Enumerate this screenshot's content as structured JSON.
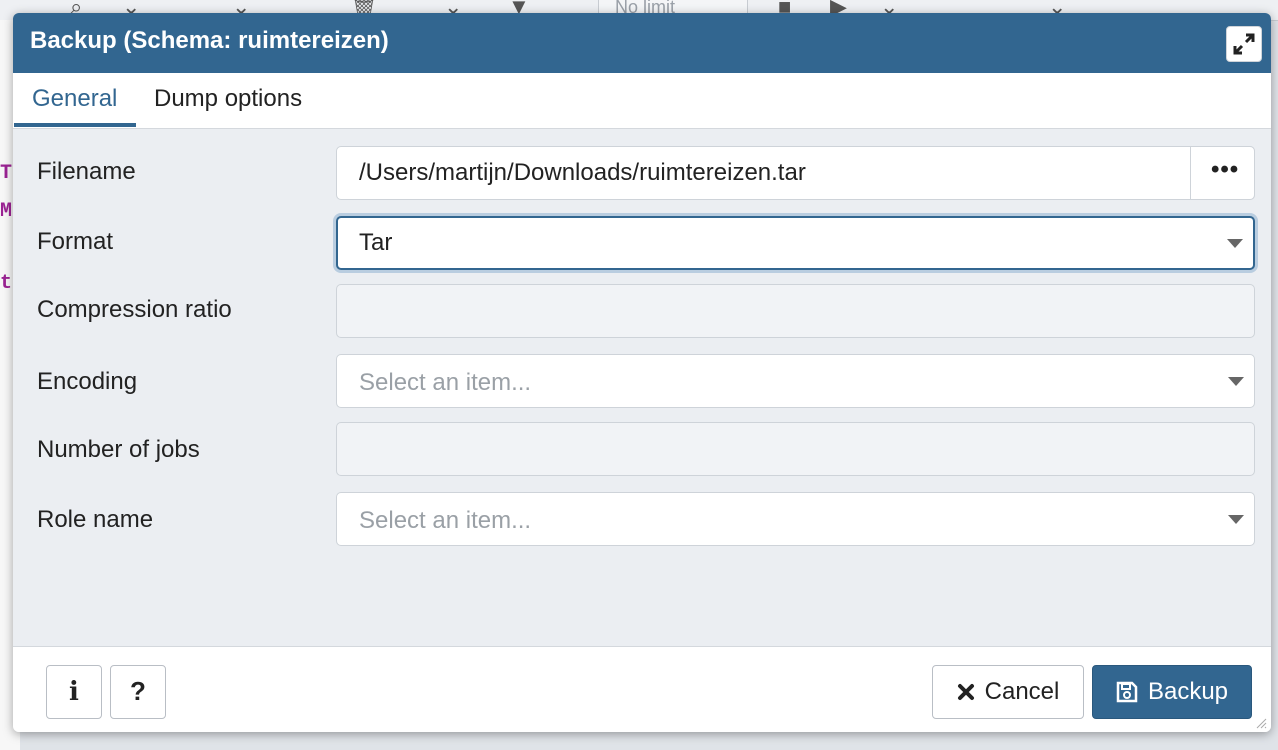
{
  "background": {
    "toolbar_limit": "No limit"
  },
  "dialog": {
    "title": "Backup (Schema: ruimtereizen)",
    "tabs": [
      {
        "label": "General",
        "active": true
      },
      {
        "label": "Dump options",
        "active": false
      }
    ],
    "fields": {
      "filename": {
        "label": "Filename",
        "value": "/Users/martijn/Downloads/ruimtereizen.tar",
        "browse_label": "•••"
      },
      "format": {
        "label": "Format",
        "value": "Tar"
      },
      "compression_ratio": {
        "label": "Compression ratio",
        "value": ""
      },
      "encoding": {
        "label": "Encoding",
        "placeholder": "Select an item..."
      },
      "number_of_jobs": {
        "label": "Number of jobs",
        "value": ""
      },
      "role_name": {
        "label": "Role name",
        "placeholder": "Select an item..."
      }
    },
    "footer": {
      "info_label": "i",
      "help_label": "?",
      "cancel_label": "Cancel",
      "backup_label": "Backup"
    }
  },
  "colors": {
    "titlebar": "#326690",
    "accent": "#326690"
  }
}
